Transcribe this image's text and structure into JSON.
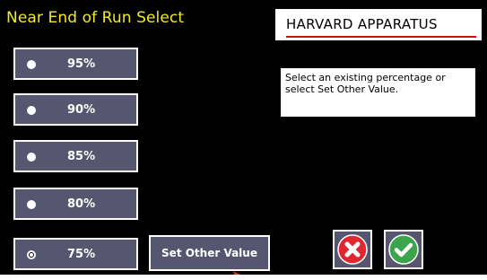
{
  "header": {
    "title": "Near End of Run Select",
    "brand": "HARVARD APPARATUS"
  },
  "options": [
    {
      "label": "95%",
      "selected": false
    },
    {
      "label": "90%",
      "selected": false
    },
    {
      "label": "85%",
      "selected": false
    },
    {
      "label": "80%",
      "selected": false
    },
    {
      "label": "75%",
      "selected": true
    }
  ],
  "set_other_label": "Set Other Value",
  "info_text": "Select an existing percentage or select Set Other Value.",
  "actions": {
    "cancel_icon": "x-circle-icon",
    "confirm_icon": "check-circle-icon"
  },
  "colors": {
    "title": "#f2ea2a",
    "button_fill": "#565670",
    "cancel": "#e0262f",
    "confirm": "#3aa54a",
    "brand_rule": "#cc1111"
  }
}
